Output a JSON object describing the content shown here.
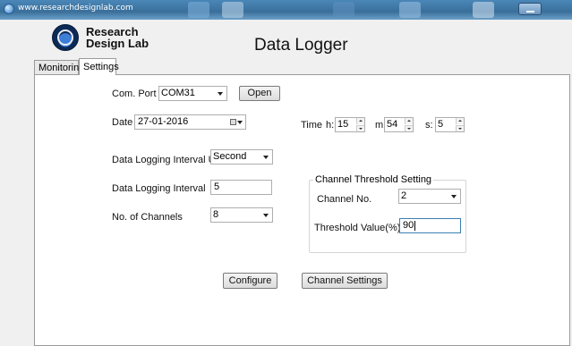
{
  "titlebar": {
    "url": "www.researchdesignlab.com"
  },
  "header": {
    "brand_line1": "Research",
    "brand_line2": "Design Lab",
    "app_title": "Data Logger"
  },
  "tabs": [
    {
      "label": "Monitoring"
    },
    {
      "label": "Settings"
    }
  ],
  "settings": {
    "com_port_label": "Com. Port",
    "com_port_value": "COM31",
    "open_label": "Open",
    "date_label": "Date",
    "date_value": "27-01-2016",
    "time_label": "Time",
    "hour_label": "h:",
    "hour_value": "15",
    "minute_label": "m:",
    "minute_value": "54",
    "second_label": "s:",
    "second_value": "5",
    "interval_unit_label": "Data Logging Interval Unit",
    "interval_unit_value": "Second",
    "interval_label": "Data Logging Interval",
    "interval_value": "5",
    "channels_label": "No. of Channels",
    "channels_value": "8",
    "threshold_group_label": "Channel Threshold Setting",
    "channel_no_label": "Channel No.",
    "channel_no_value": "2",
    "threshold_value_label": "Threshold Value(%)",
    "threshold_value": "90",
    "configure_label": "Configure",
    "channel_settings_label": "Channel Settings"
  }
}
